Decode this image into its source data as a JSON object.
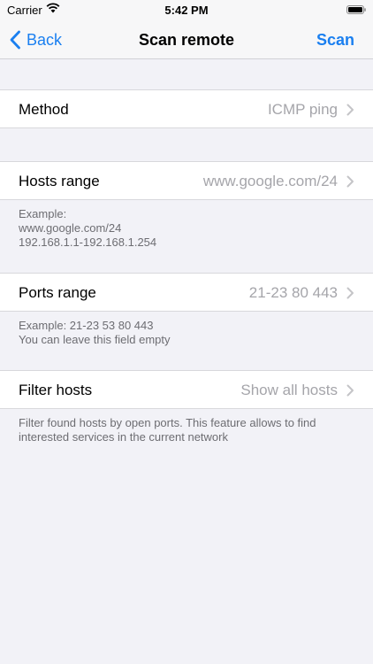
{
  "status_bar": {
    "carrier": "Carrier",
    "time": "5:42 PM"
  },
  "nav": {
    "back_label": "Back",
    "title": "Scan remote",
    "action_label": "Scan"
  },
  "settings": {
    "method": {
      "label": "Method",
      "value": "ICMP ping"
    },
    "hosts_range": {
      "label": "Hosts range",
      "value": "www.google.com/24",
      "footer": [
        "Example:",
        "www.google.com/24",
        "192.168.1.1-192.168.1.254"
      ]
    },
    "ports_range": {
      "label": "Ports range",
      "value": "21-23 80 443",
      "footer": [
        "Example: 21-23 53 80 443",
        "You can leave this field empty"
      ]
    },
    "filter_hosts": {
      "label": "Filter hosts",
      "value": "Show all hosts",
      "footer": [
        "Filter found hosts by open ports. This feature allows to find",
        "interested services in the current network"
      ]
    }
  },
  "colors": {
    "accent": "#1a7ff0",
    "background": "#f2f2f7",
    "secondary_text": "#a5a5aa"
  }
}
